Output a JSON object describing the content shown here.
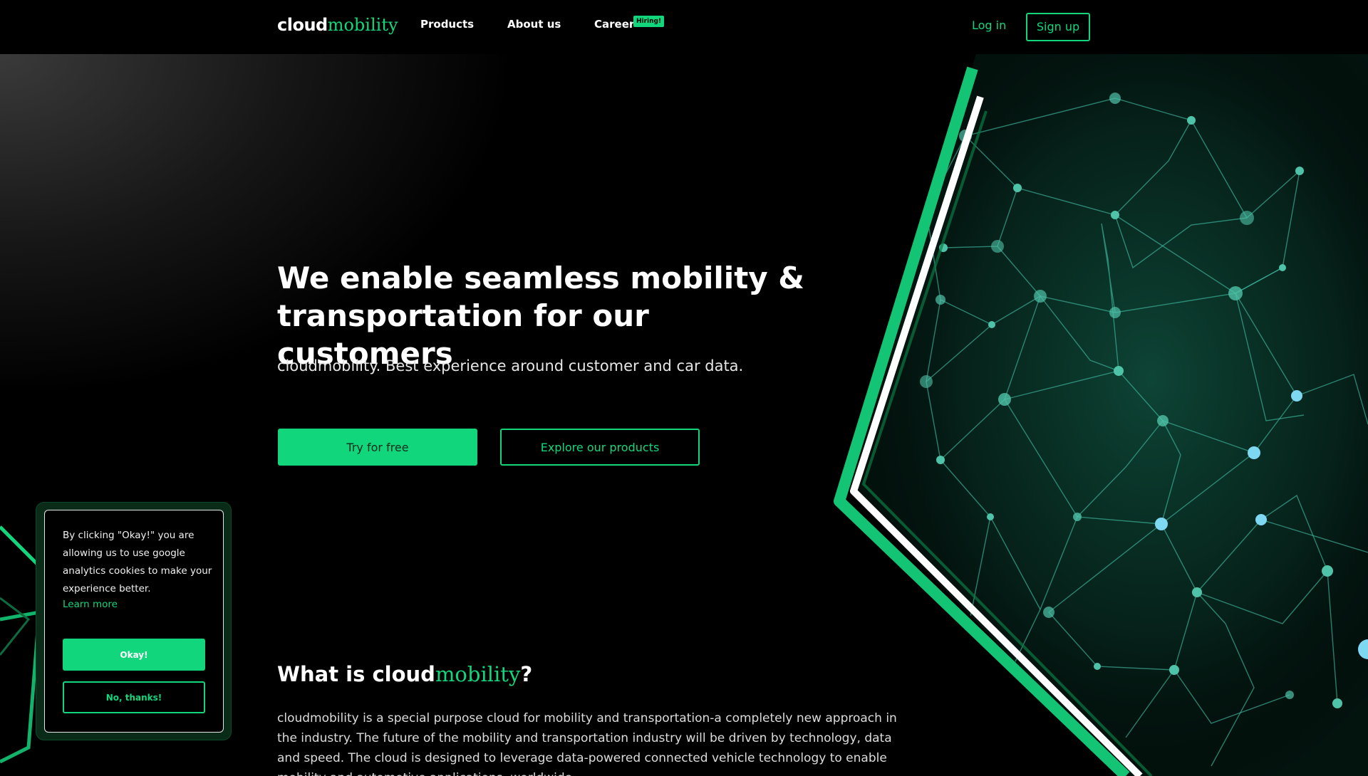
{
  "brand": {
    "logo_part1": "cloud",
    "logo_part2": "mobility",
    "accent_color": "#12d67c"
  },
  "nav": {
    "products": "Products",
    "about": "About us",
    "career": "Career",
    "hiring_badge": "Hiring!",
    "login": "Log in",
    "signup": "Sign up"
  },
  "hero": {
    "title": "We enable seamless mobility & transportation for our customers",
    "subtitle": "cloudmobility. Best experience around customer and car data.",
    "try_button": "Try for free",
    "explore_button": "Explore our products"
  },
  "what": {
    "title_prefix": "What is ",
    "title_suffix": "?",
    "body": "cloudmobility is a special purpose cloud for mobility and transportation-a completely new approach in the industry. The future of the mobility and transportation industry will be driven by technology, data and speed. The cloud is designed to leverage data-powered connected vehicle technology to enable mobility and automotive applications, worldwide."
  },
  "cookie": {
    "text": "By clicking \"Okay!\" you are allowing us to use google analytics cookies to make your experience better.",
    "learn_more": "Learn more",
    "okay": "Okay!",
    "no_thanks": "No, thanks!"
  },
  "icons": {
    "network": "network-graphic"
  }
}
